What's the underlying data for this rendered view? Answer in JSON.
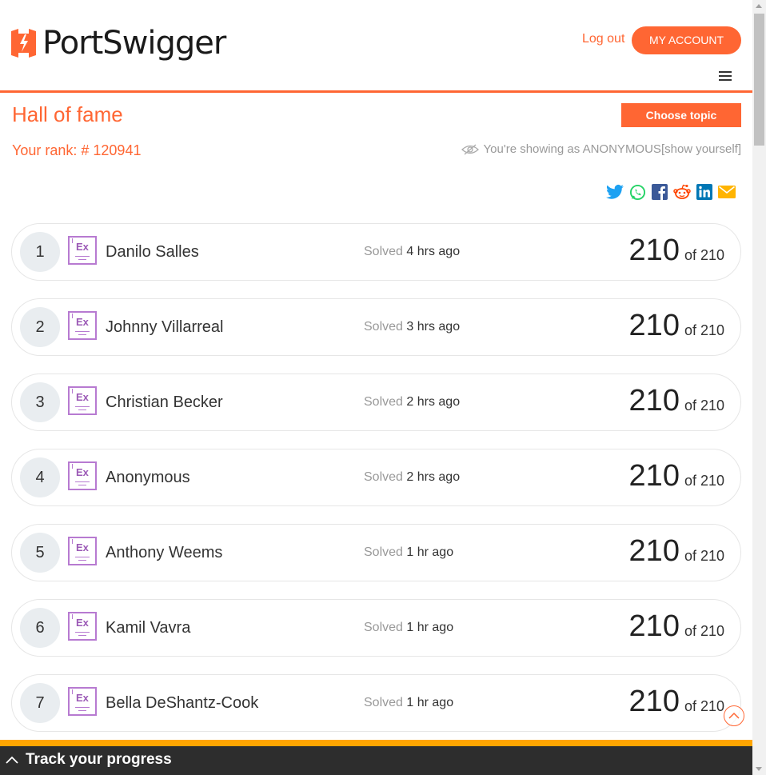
{
  "header": {
    "brand": "PortSwigger",
    "logout_label": "Log out",
    "account_label": "MY ACCOUNT"
  },
  "page": {
    "title": "Hall of fame",
    "choose_topic_label": "Choose topic",
    "rank_label": "Your rank: # 120941",
    "anon_text": "You're showing as ANONYMOUS ",
    "show_yourself_label": "[show yourself]"
  },
  "share_icons": [
    "twitter-icon",
    "whatsapp-icon",
    "facebook-icon",
    "reddit-icon",
    "linkedin-icon",
    "email-icon"
  ],
  "leaderboard": [
    {
      "rank": "1",
      "badge": "Ex",
      "name": "Danilo Salles",
      "solved_label": "Solved",
      "ago": "4 hrs ago",
      "score": "210",
      "of": "of 210"
    },
    {
      "rank": "2",
      "badge": "Ex",
      "name": "Johnny Villarreal",
      "solved_label": "Solved",
      "ago": "3 hrs ago",
      "score": "210",
      "of": "of 210"
    },
    {
      "rank": "3",
      "badge": "Ex",
      "name": "Christian Becker",
      "solved_label": "Solved",
      "ago": "2 hrs ago",
      "score": "210",
      "of": "of 210"
    },
    {
      "rank": "4",
      "badge": "Ex",
      "name": "Anonymous",
      "solved_label": "Solved",
      "ago": "2 hrs ago",
      "score": "210",
      "of": "of 210"
    },
    {
      "rank": "5",
      "badge": "Ex",
      "name": "Anthony Weems",
      "solved_label": "Solved",
      "ago": "1 hr ago",
      "score": "210",
      "of": "of 210"
    },
    {
      "rank": "6",
      "badge": "Ex",
      "name": "Kamil Vavra",
      "solved_label": "Solved",
      "ago": "1 hr ago",
      "score": "210",
      "of": "of 210"
    },
    {
      "rank": "7",
      "badge": "Ex",
      "name": "Bella DeShantz-Cook",
      "solved_label": "Solved",
      "ago": "1 hr ago",
      "score": "210",
      "of": "of 210"
    }
  ],
  "footer": {
    "track_label": "Track your progress"
  },
  "colors": {
    "accent": "#ff6633",
    "badge_purple": "#9b59b6",
    "footer_bar": "#ffa500",
    "footer_bg": "#2d2d2d"
  }
}
